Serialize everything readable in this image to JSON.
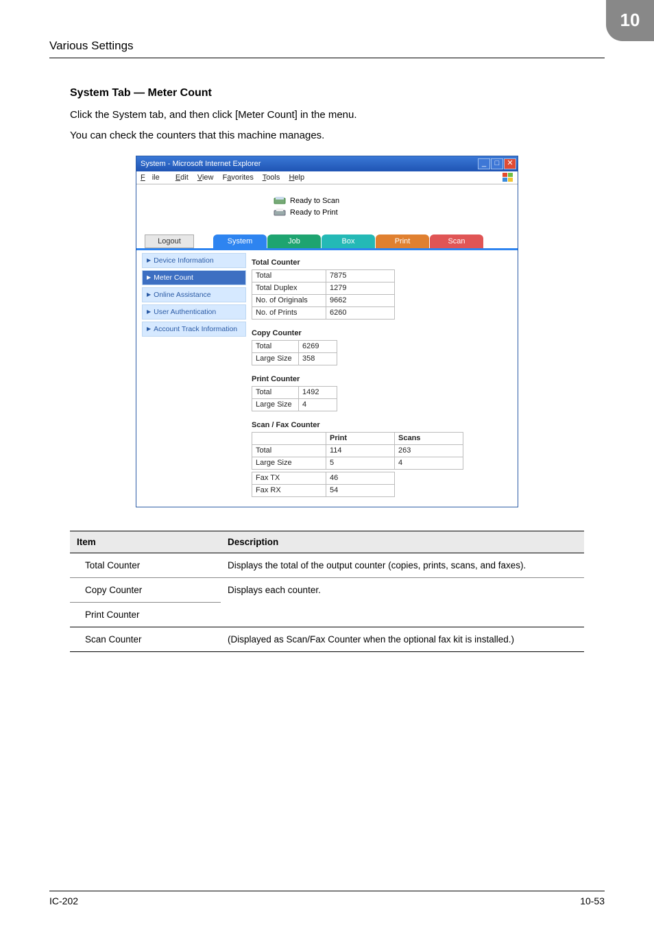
{
  "header": {
    "left": "Various Settings",
    "badge": "10"
  },
  "section": {
    "title": "System Tab — Meter Count",
    "p1": "Click the System tab, and then click [Meter Count] in the menu.",
    "p2": "You can check the counters that this machine manages."
  },
  "ie": {
    "title": "System - Microsoft Internet Explorer",
    "menus": {
      "file": "File",
      "edit": "Edit",
      "view": "View",
      "fav": "Favorites",
      "tools": "Tools",
      "help": "Help"
    },
    "status": {
      "scan": "Ready to Scan",
      "print": "Ready to Print"
    },
    "tabs": {
      "logout": "Logout",
      "system": "System",
      "job": "Job",
      "box": "Box",
      "print": "Print",
      "scan": "Scan"
    },
    "sidebar": {
      "devinfo": "Device Information",
      "meter": "Meter Count",
      "online": "Online Assistance",
      "userauth": "User Authentication",
      "acct": "Account Track Information"
    },
    "sections": {
      "total": "Total Counter",
      "copy": "Copy Counter",
      "printc": "Print Counter",
      "scanfax": "Scan / Fax Counter"
    },
    "labels": {
      "total": "Total",
      "duplex": "Total Duplex",
      "orig": "No. of Originals",
      "prints": "No. of Prints",
      "large": "Large Size",
      "faxtx": "Fax TX",
      "faxrx": "Fax RX",
      "print": "Print",
      "scans": "Scans"
    }
  },
  "chart_data": {
    "type": "table",
    "total_counter": {
      "Total": 7875,
      "Total Duplex": 1279,
      "No. of Originals": 9662,
      "No. of Prints": 6260
    },
    "copy_counter": {
      "Total": 6269,
      "Large Size": 358
    },
    "print_counter": {
      "Total": 1492,
      "Large Size": 4
    },
    "scan_fax_counter": {
      "Total": {
        "Print": 114,
        "Scans": 263
      },
      "Large Size": {
        "Print": 5,
        "Scans": 4
      },
      "Fax TX": 46,
      "Fax RX": 54
    }
  },
  "desc": {
    "h_item": "Item",
    "h_desc": "Description",
    "r1_item": "Total Counter",
    "r1_desc": "Displays the total of the output counter (copies, prints, scans, and faxes).",
    "r2_item": "Copy Counter",
    "r2_desc": "Displays each counter.",
    "r3_item": "Print Counter",
    "r4_item": "Scan Counter",
    "r4_desc": "(Displayed as Scan/Fax Counter when the optional fax kit is installed.)"
  },
  "footer": {
    "left": "IC-202",
    "right": "10-53"
  }
}
